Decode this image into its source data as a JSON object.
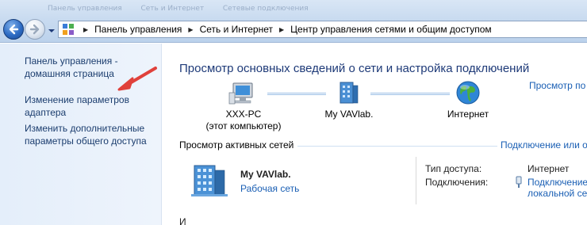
{
  "window": {
    "tabs_faded": [
      "Панель управления",
      "Сеть и Интернет",
      "Сетевые подключения"
    ]
  },
  "navigation": {
    "icons": {
      "back": "back-arrow-icon",
      "forward": "forward-arrow-icon",
      "recent": "chevron-down-icon"
    }
  },
  "address_bar": {
    "icon": "control-panel-icon",
    "breadcrumbs": [
      "Панель управления",
      "Сеть и Интернет",
      "Центр управления сетями и общим доступом"
    ]
  },
  "sidebar": {
    "links": [
      {
        "line1": "Панель управления -",
        "line2": "домашняя страница"
      },
      {
        "line1": "Изменение параметров",
        "line2": "адаптера"
      },
      {
        "line1": "Изменить дополнительные",
        "line2": "параметры общего доступа"
      }
    ],
    "annotation_color": "#e0413b"
  },
  "main": {
    "title": "Просмотр основных сведений о сети и настройка подключений",
    "view_full_map": "Просмотр по",
    "network_map": {
      "computer_name": "XXX-PC",
      "computer_sub": "(этот компьютер)",
      "network_name": "My VAVlab.",
      "internet": "Интернет",
      "icons": [
        "computer-icon",
        "network-icon",
        "globe-icon"
      ]
    },
    "active_networks": {
      "header": "Просмотр активных сетей",
      "connect_link": "Подключение или о",
      "network": {
        "name": "My VAVlab.",
        "type_link": "Рабочая сеть",
        "icon": "building-network-icon"
      },
      "access_type_label": "Тип доступа:",
      "access_type_value": "Интернет",
      "connections_label": "Подключения:",
      "connection_link_line1": "Подключение",
      "connection_link_line2": "локальной сет"
    },
    "next_section_partial": "И"
  },
  "colors": {
    "title_blue": "#1e3a78",
    "link_blue": "#1a5fb4",
    "sidebar_bg": "#e4eefa"
  }
}
